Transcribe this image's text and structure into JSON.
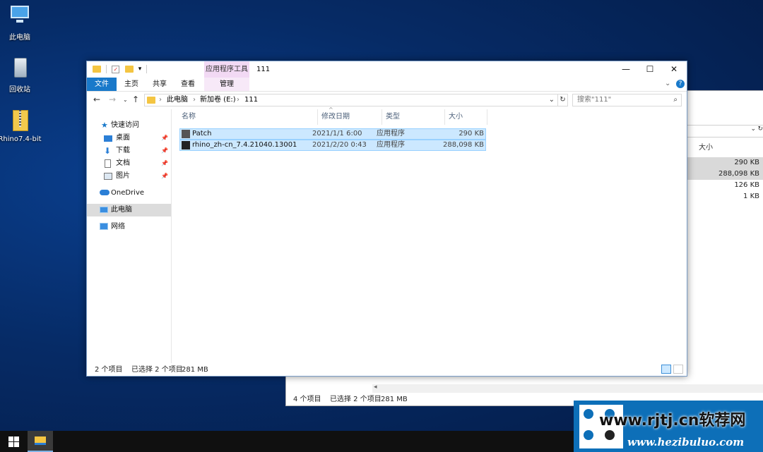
{
  "desktop": {
    "icons": [
      {
        "label": "此电脑"
      },
      {
        "label": "回收站"
      },
      {
        "label": "Rhino7.4-bit"
      }
    ]
  },
  "window": {
    "title": "111",
    "context_tab_group": "应用程序工具",
    "ribbon_tabs": [
      "文件",
      "主页",
      "共享",
      "查看",
      "管理"
    ],
    "address": {
      "segments": [
        "此电脑",
        "新加卷 (E:)",
        "111"
      ]
    },
    "search_placeholder": "搜索\"111\"",
    "nav": {
      "quick_access": "快速访问",
      "pinned": [
        "桌面",
        "下载",
        "文档",
        "图片"
      ],
      "onedrive": "OneDrive",
      "this_pc": "此电脑",
      "network": "网络"
    },
    "columns": [
      "名称",
      "修改日期",
      "类型",
      "大小"
    ],
    "files": [
      {
        "name": "Patch",
        "date": "2021/1/1 6:00",
        "type": "应用程序",
        "size": "290 KB"
      },
      {
        "name": "rhino_zh-cn_7.4.21040.13001",
        "date": "2021/2/20 0:43",
        "type": "应用程序",
        "size": "288,098 KB"
      }
    ],
    "status": {
      "count": "2 个项目",
      "selection": "已选择 2 个项目",
      "size": "281 MB"
    }
  },
  "background_window": {
    "column": "大小",
    "sizes": [
      "290 KB",
      "288,098 KB",
      "126 KB",
      "1 KB"
    ],
    "status": {
      "count": "4 个项目",
      "selection": "已选择 2 个项目",
      "size": "281 MB"
    }
  },
  "watermark": {
    "line1": "www.rjtj.cn软荐网",
    "line2": "www.hezibuluo.com"
  },
  "colors": {
    "accent": "#1979ca",
    "selection": "#cce8ff",
    "context_tab": "#f2d9f4"
  }
}
